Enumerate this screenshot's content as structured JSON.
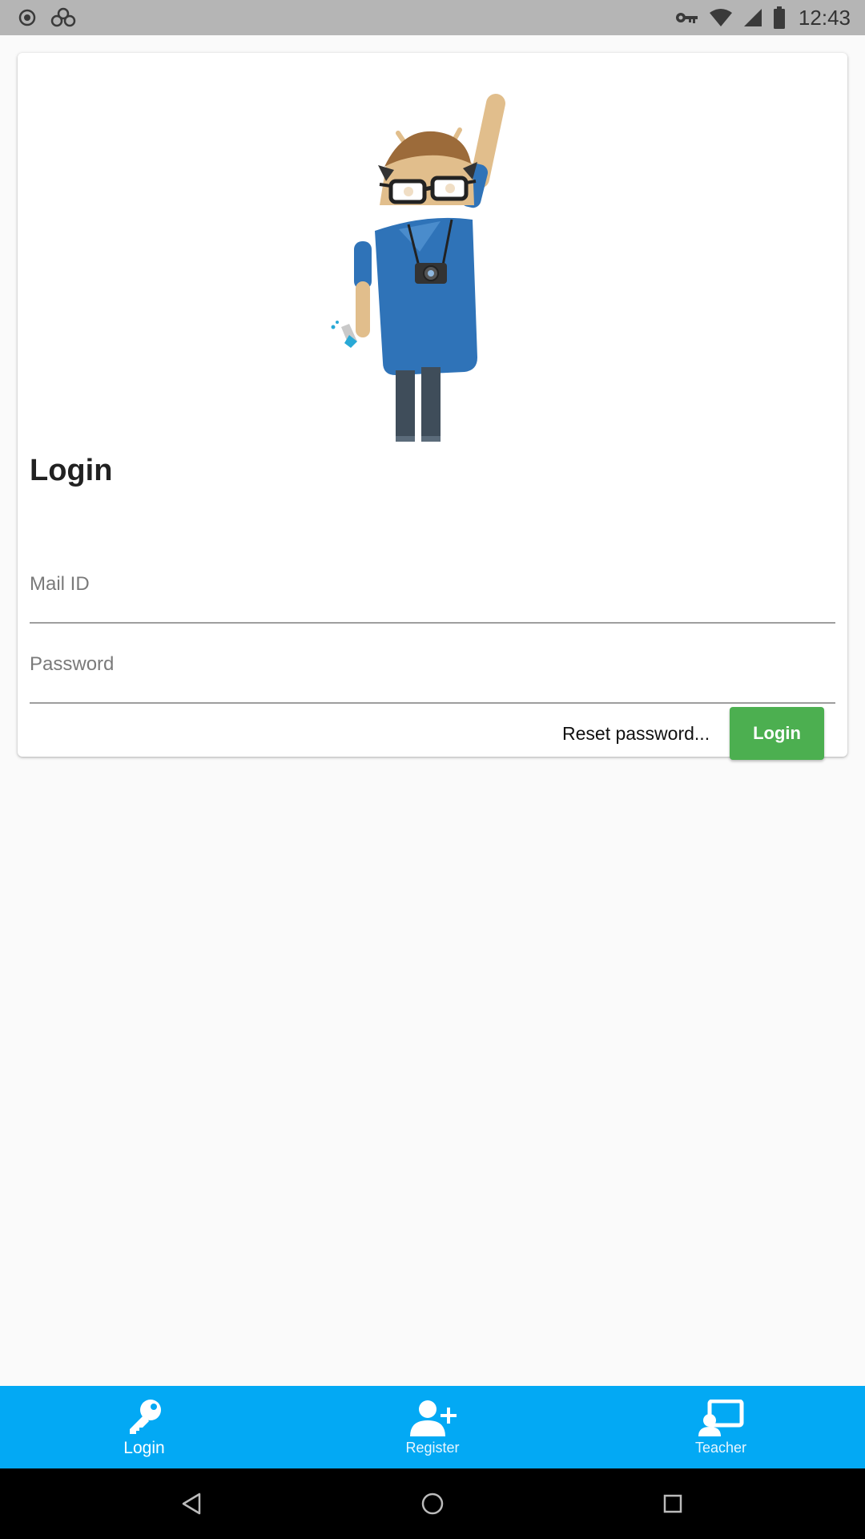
{
  "status_bar": {
    "time": "12:43",
    "left_icons": [
      "record-icon",
      "app-notification-icon"
    ],
    "right_icons": [
      "vpn-key-icon",
      "wifi-icon",
      "cell-signal-icon",
      "battery-icon"
    ]
  },
  "card": {
    "illustration": "android-mascot",
    "title": "Login",
    "mail_placeholder": "Mail ID",
    "password_placeholder": "Password",
    "reset_label": "Reset password...",
    "login_button_label": "Login"
  },
  "bottom_nav": {
    "items": [
      {
        "label": "Login",
        "icon": "key-icon",
        "active": true
      },
      {
        "label": "Register",
        "icon": "add-person-icon",
        "active": false
      },
      {
        "label": "Teacher",
        "icon": "teacher-screen-icon",
        "active": false
      }
    ]
  },
  "system_nav": [
    "back-icon",
    "home-icon",
    "recents-icon"
  ],
  "colors": {
    "status_bar": "#b5b5b5",
    "bottom_nav": "#03a9f4",
    "login_button": "#4caf50",
    "background": "#fafafa"
  }
}
